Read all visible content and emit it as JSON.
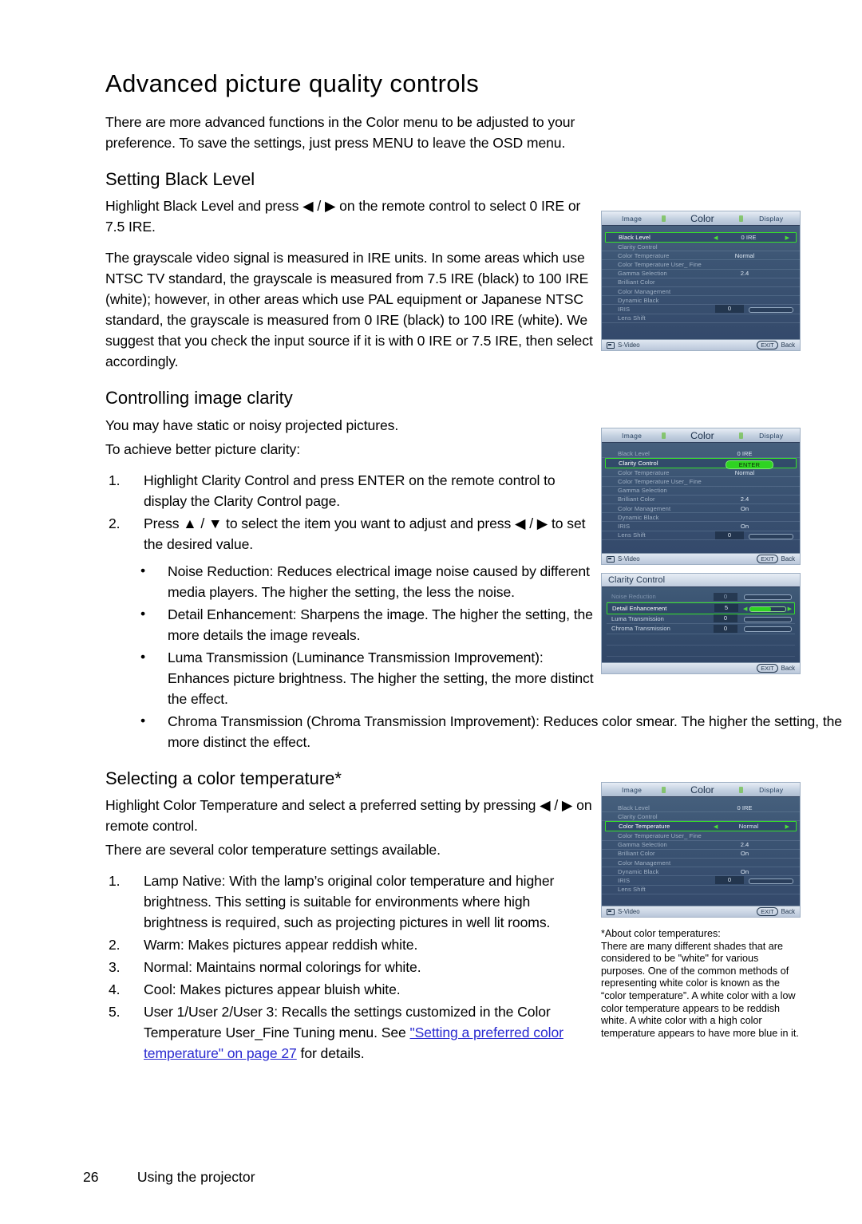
{
  "page": {
    "title": "Advanced picture quality controls",
    "footer_page_number": "26",
    "footer_section": "Using the projector"
  },
  "intro": {
    "paragraph": "There are more advanced functions in the Color menu to be adjusted to your preference. To save the settings, just press MENU to leave the OSD menu."
  },
  "black_level": {
    "heading": "Setting Black Level",
    "p1": "Highlight Black Level and press ◀ / ▶ on the remote control to select 0 IRE or 7.5 IRE.",
    "p2": "The grayscale video signal is measured in IRE units. In some areas which use NTSC TV standard, the grayscale is measured from 7.5 IRE (black) to 100 IRE (white); however, in other areas which use PAL equipment or Japanese NTSC standard, the grayscale is measured from 0 IRE (black) to 100 IRE (white). We suggest that you check the input source if it is with 0 IRE or 7.5 IRE, then select accordingly."
  },
  "clarity": {
    "heading": "Controlling image clarity",
    "p1": "You may have static or noisy projected pictures.",
    "p2": "To achieve better picture clarity:",
    "steps": [
      {
        "num": "1.",
        "text": "Highlight Clarity Control and press ENTER on the remote control to display the Clarity Control page."
      },
      {
        "num": "2.",
        "text": "Press ▲ / ▼ to select the item you want to adjust and press ◀ / ▶ to set the desired value."
      }
    ],
    "bullets": [
      {
        "bullet": "•",
        "text": "Noise Reduction: Reduces electrical image noise caused by different media players. The higher the setting, the less the noise."
      },
      {
        "bullet": "•",
        "text": "Detail Enhancement: Sharpens the image. The higher the setting, the more details the image reveals."
      },
      {
        "bullet": "•",
        "text": "Luma Transmission (Luminance Transmission Improvement): Enhances picture brightness. The higher the setting, the more distinct the effect."
      },
      {
        "bullet": "•",
        "text": "Chroma Transmission (Chroma Transmission Improvement): Reduces color smear. The higher the setting, the more distinct the effect."
      }
    ]
  },
  "color_temp": {
    "heading": "Selecting a color temperature*",
    "p1": "Highlight Color Temperature and select a preferred setting by pressing ◀ / ▶ on remote control.",
    "p2": "There are several color temperature settings available.",
    "steps": [
      {
        "num": "1.",
        "text": "Lamp Native: With the lamp’s original color temperature and higher brightness. This setting is suitable for environments where high brightness is required, such as projecting pictures in well lit rooms."
      },
      {
        "num": "2.",
        "text": "Warm: Makes pictures appear reddish white."
      },
      {
        "num": "3.",
        "text": "Normal: Maintains normal colorings for white."
      },
      {
        "num": "4.",
        "text": "Cool: Makes pictures appear bluish white."
      }
    ],
    "step5": {
      "num": "5.",
      "pre": "User 1/User 2/User 3: Recalls the settings customized in the Color Temperature User_Fine Tuning menu. See ",
      "link": "\"Setting a preferred color temperature\" on page 27",
      "post": " for details."
    }
  },
  "sidenote": {
    "title": "*About color temperatures:",
    "text": "There are many different shades that are considered to be \"white\" for various purposes. One of the common methods of representing white color is known as the “color temperature”. A white color with a low color temperature appears to be reddish white. A white color with a high color temperature appears to have more blue in it."
  },
  "osd_common": {
    "tabs": {
      "image": "Image",
      "color": "Color",
      "display": "Display"
    },
    "footer": {
      "source": "S-Video",
      "exit": "EXIT",
      "back": "Back"
    },
    "colors": {
      "highlight_green": "#35e02a",
      "panel_blue": "#3c5574",
      "tab_bar": "#c3d0e0"
    }
  },
  "osd1": {
    "rows": [
      {
        "label": "Black Level",
        "value": "0 IRE",
        "highlight": true,
        "carets": true,
        "dim": false,
        "slider": false
      },
      {
        "label": "Clarity Control",
        "value": "",
        "highlight": false,
        "carets": false,
        "dim": true,
        "slider": false
      },
      {
        "label": "Color Temperature",
        "value": "Normal",
        "highlight": false,
        "carets": false,
        "dim": true,
        "slider": false
      },
      {
        "label": "Color Temperature User_ Fine",
        "value": "",
        "highlight": false,
        "carets": false,
        "dim": true,
        "slider": false
      },
      {
        "label": "Gamma Selection",
        "value": "2.4",
        "highlight": false,
        "carets": false,
        "dim": true,
        "slider": false
      },
      {
        "label": "Brilliant Color",
        "value": "",
        "highlight": false,
        "carets": false,
        "dim": true,
        "slider": false
      },
      {
        "label": "Color Management",
        "value": "",
        "highlight": false,
        "carets": false,
        "dim": true,
        "slider": false
      },
      {
        "label": "Dynamic Black",
        "value": "",
        "highlight": false,
        "carets": false,
        "dim": true,
        "slider": false
      },
      {
        "label": "IRIS",
        "value": "0",
        "highlight": false,
        "carets": false,
        "dim": true,
        "slider": true
      },
      {
        "label": "Lens Shift",
        "value": "",
        "highlight": false,
        "carets": false,
        "dim": true,
        "slider": false
      }
    ]
  },
  "osd2": {
    "enter_label": "ENTER",
    "rows": [
      {
        "label": "Black Level",
        "value": "0 IRE",
        "highlight": false,
        "dim": true,
        "slider": false
      },
      {
        "label": "Clarity Control",
        "value": "ENTER",
        "highlight": true,
        "dim": false,
        "slider": false
      },
      {
        "label": "Color Temperature",
        "value": "Normal",
        "highlight": false,
        "dim": true,
        "slider": false
      },
      {
        "label": "Color Temperature User_ Fine",
        "value": "",
        "highlight": false,
        "dim": true,
        "slider": false
      },
      {
        "label": "Gamma Selection",
        "value": "",
        "highlight": false,
        "dim": true,
        "slider": false
      },
      {
        "label": "Brilliant Color",
        "value": "2.4",
        "highlight": false,
        "dim": true,
        "slider": false
      },
      {
        "label": "Color Management",
        "value": "On",
        "highlight": false,
        "dim": true,
        "slider": false
      },
      {
        "label": "Dynamic Black",
        "value": "",
        "highlight": false,
        "dim": true,
        "slider": false
      },
      {
        "label": "IRIS",
        "value": "On",
        "highlight": false,
        "dim": true,
        "slider": false
      },
      {
        "label": "Lens Shift",
        "value": "0",
        "highlight": false,
        "dim": true,
        "slider": true
      }
    ]
  },
  "osd_clarity": {
    "title": "Clarity Control",
    "rows": [
      {
        "label": "Noise Reduction",
        "value": "0",
        "highlight": false,
        "dim": true
      },
      {
        "label": "Detail Enhancement",
        "value": "5",
        "highlight": true,
        "dim": false
      },
      {
        "label": "Luma Transmission",
        "value": "0",
        "highlight": false,
        "dim": false
      },
      {
        "label": "Chroma Transmission",
        "value": "0",
        "highlight": false,
        "dim": false
      }
    ],
    "footer": {
      "exit": "EXIT",
      "back": "Back"
    }
  },
  "osd4": {
    "rows": [
      {
        "label": "Black Level",
        "value": "0 IRE",
        "highlight": false,
        "carets": false,
        "dim": true,
        "slider": false
      },
      {
        "label": "Clarity Control",
        "value": "",
        "highlight": false,
        "carets": false,
        "dim": true,
        "slider": false
      },
      {
        "label": "Color Temperature",
        "value": "Normal",
        "highlight": true,
        "carets": true,
        "dim": false,
        "slider": false
      },
      {
        "label": "Color Temperature User_ Fine",
        "value": "",
        "highlight": false,
        "carets": false,
        "dim": true,
        "slider": false
      },
      {
        "label": "Gamma Selection",
        "value": "2.4",
        "highlight": false,
        "carets": false,
        "dim": true,
        "slider": false
      },
      {
        "label": "Brilliant Color",
        "value": "On",
        "highlight": false,
        "carets": false,
        "dim": true,
        "slider": false
      },
      {
        "label": "Color Management",
        "value": "",
        "highlight": false,
        "carets": false,
        "dim": true,
        "slider": false
      },
      {
        "label": "Dynamic Black",
        "value": "On",
        "highlight": false,
        "carets": false,
        "dim": true,
        "slider": false
      },
      {
        "label": "IRIS",
        "value": "0",
        "highlight": false,
        "carets": false,
        "dim": true,
        "slider": true
      },
      {
        "label": "Lens Shift",
        "value": "",
        "highlight": false,
        "carets": false,
        "dim": true,
        "slider": false
      }
    ]
  }
}
